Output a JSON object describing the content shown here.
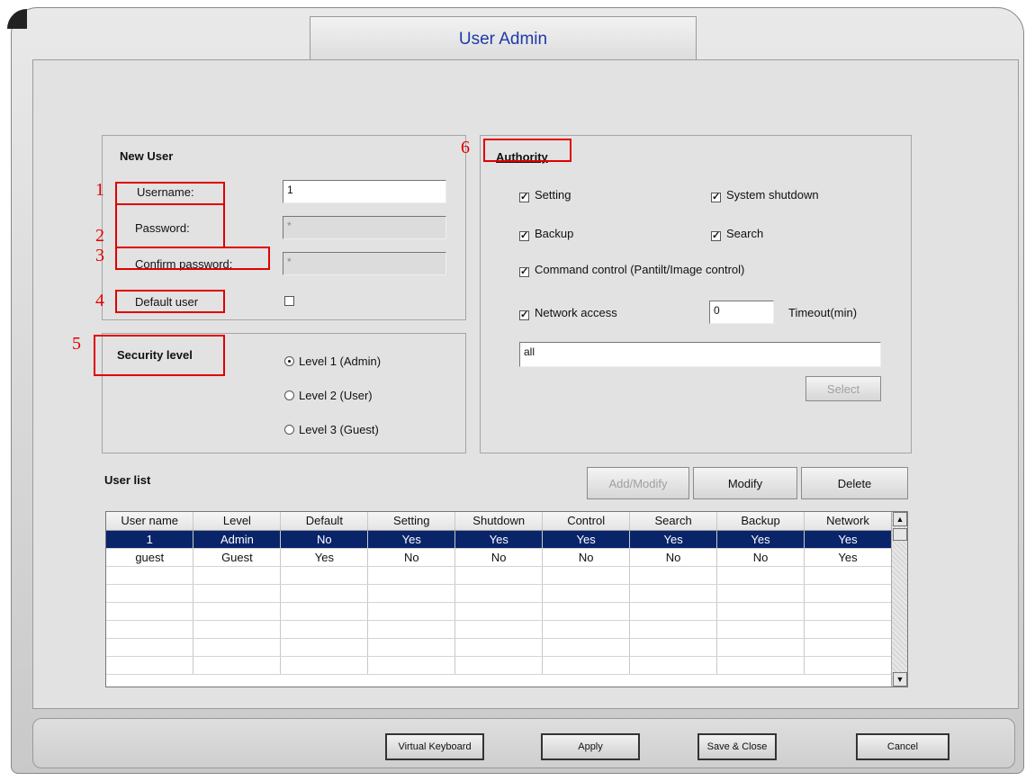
{
  "window": {
    "title": "User Admin"
  },
  "new_user": {
    "title": "New User",
    "username_label": "Username:",
    "username_value": "1",
    "password_label": "Password:",
    "password_value": "*",
    "confirm_label": "Confirm password:",
    "confirm_value": "*",
    "default_user_label": "Default user",
    "default_user_checked": false
  },
  "security": {
    "title": "Security level",
    "options": [
      "Level 1 (Admin)",
      "Level 2 (User)",
      "Level 3 (Guest)"
    ],
    "selected": "Level 1 (Admin)"
  },
  "authority": {
    "title": "Authority",
    "setting": "Setting",
    "system_shutdown": "System shutdown",
    "backup": "Backup",
    "search": "Search",
    "command_control": "Command control (Pantilt/Image control)",
    "network_access": "Network access",
    "timeout_value": "0",
    "timeout_label": "Timeout(min)",
    "network_value": "all",
    "select_button": "Select"
  },
  "callouts": [
    "1",
    "2",
    "3",
    "4",
    "5",
    "6"
  ],
  "user_list": {
    "title": "User list",
    "add_modify": "Add/Modify",
    "modify": "Modify",
    "delete": "Delete",
    "columns": [
      "User name",
      "Level",
      "Default",
      "Setting",
      "Shutdown",
      "Control",
      "Search",
      "Backup",
      "Network"
    ],
    "rows": [
      [
        "1",
        "Admin",
        "No",
        "Yes",
        "Yes",
        "Yes",
        "Yes",
        "Yes",
        "Yes"
      ],
      [
        "guest",
        "Guest",
        "Yes",
        "No",
        "No",
        "No",
        "No",
        "No",
        "Yes"
      ]
    ],
    "selected_row": 0
  },
  "footer": {
    "virtual_keyboard": "Virtual Keyboard",
    "apply": "Apply",
    "save_close": "Save & Close",
    "cancel": "Cancel"
  },
  "colors": {
    "title": "#1f3aa8",
    "callout": "#e00000",
    "selection": "#0a246a"
  }
}
